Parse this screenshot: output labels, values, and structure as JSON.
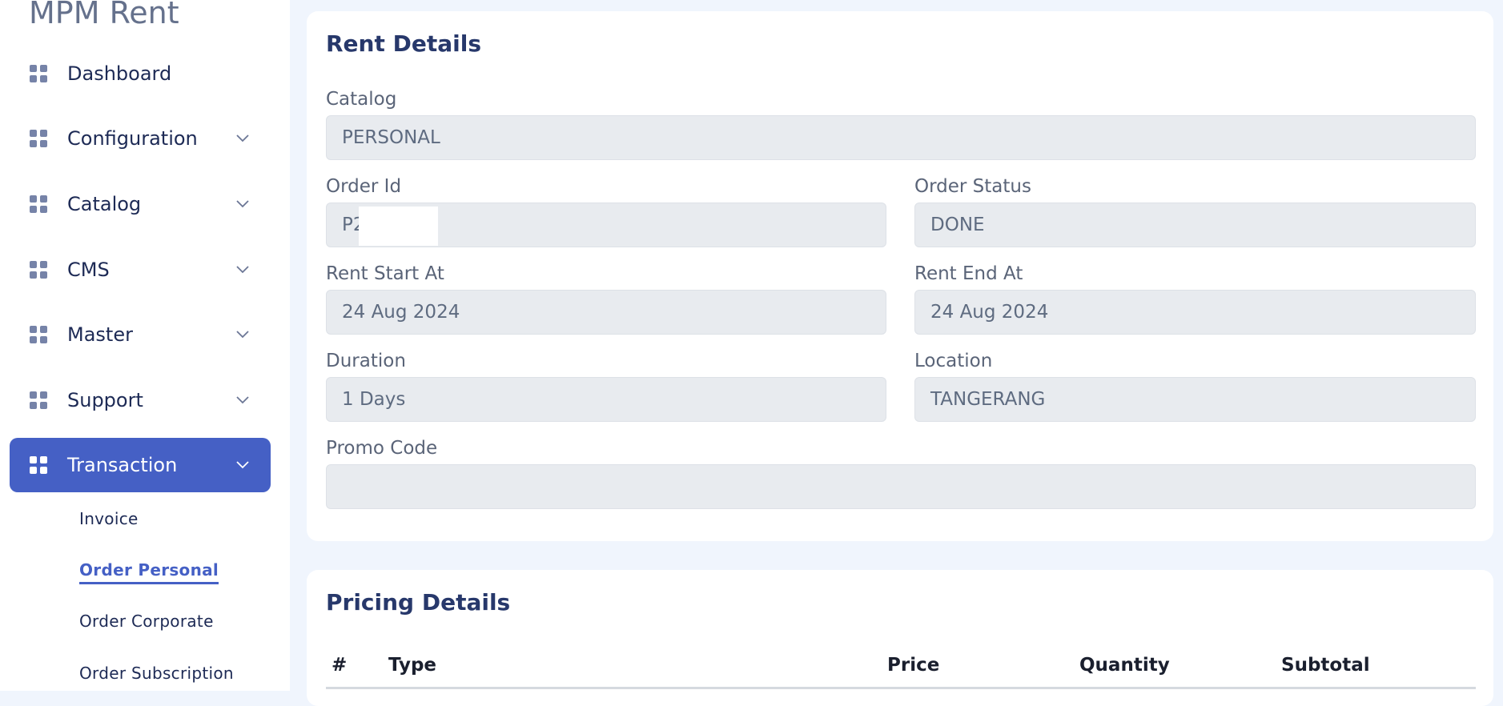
{
  "sidebar": {
    "brand": "MPM Rent",
    "items": [
      {
        "label": "Dashboard",
        "icon": "grid-icon"
      },
      {
        "label": "Configuration",
        "icon": "grid-icon"
      },
      {
        "label": "Catalog",
        "icon": "grid-icon"
      },
      {
        "label": "CMS",
        "icon": "grid-icon"
      },
      {
        "label": "Master",
        "icon": "grid-icon"
      },
      {
        "label": "Support",
        "icon": "grid-icon"
      },
      {
        "label": "Transaction",
        "icon": "grid-icon",
        "active": true
      }
    ],
    "subitems": [
      {
        "label": "Invoice"
      },
      {
        "label": "Order Personal",
        "active": true
      },
      {
        "label": "Order Corporate"
      },
      {
        "label": "Order Subscription"
      }
    ]
  },
  "rent_details": {
    "title": "Rent Details",
    "catalog": {
      "label": "Catalog",
      "value": "PERSONAL"
    },
    "order_id": {
      "label": "Order Id",
      "value": "P2        37"
    },
    "order_status": {
      "label": "Order Status",
      "value": "DONE"
    },
    "rent_start": {
      "label": "Rent Start At",
      "value": "24 Aug 2024"
    },
    "rent_end": {
      "label": "Rent End At",
      "value": "24 Aug 2024"
    },
    "duration": {
      "label": "Duration",
      "value": "1 Days"
    },
    "location": {
      "label": "Location",
      "value": "TANGERANG"
    },
    "promo_code": {
      "label": "Promo Code",
      "value": ""
    }
  },
  "pricing_details": {
    "title": "Pricing Details",
    "columns": [
      "#",
      "Type",
      "Price",
      "Quantity",
      "Subtotal"
    ]
  },
  "colors": {
    "accent": "#4560c5",
    "page_bg": "#f0f5fd",
    "input_bg": "#e8ebef",
    "text_dark": "#1d2a55"
  }
}
